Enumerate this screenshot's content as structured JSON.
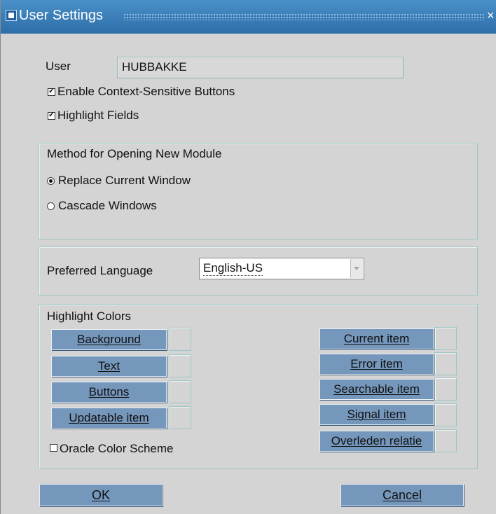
{
  "window": {
    "title": "User Settings",
    "close_glyph": "×"
  },
  "user": {
    "label": "User",
    "value": "HUBBAKKE"
  },
  "options": {
    "context_buttons": {
      "label": "Enable Context-Sensitive Buttons",
      "checked": true
    },
    "highlight_fields": {
      "label": "Highlight Fields",
      "checked": true
    }
  },
  "module_method": {
    "title": "Method for Opening New Module",
    "options": [
      {
        "label": "Replace Current Window",
        "selected": true
      },
      {
        "label": "Cascade Windows",
        "selected": false
      }
    ]
  },
  "language": {
    "label": "Preferred Language",
    "value": "English-US"
  },
  "highlight_colors": {
    "title": "Highlight Colors",
    "left_buttons": [
      "Background",
      "Text",
      "Buttons",
      "Updatable item"
    ],
    "right_buttons": [
      "Current item",
      "Error item",
      "Searchable item",
      "Signal item",
      "Overleden relatie"
    ],
    "oracle_scheme": {
      "label": "Oracle Color Scheme",
      "checked": false
    }
  },
  "footer": {
    "ok_label": "OK",
    "cancel_label": "Cancel"
  },
  "colors": {
    "button_bg": "#7597bc",
    "title_bar": "#3a7cb8",
    "dialog_bg": "#d4d4d4"
  }
}
